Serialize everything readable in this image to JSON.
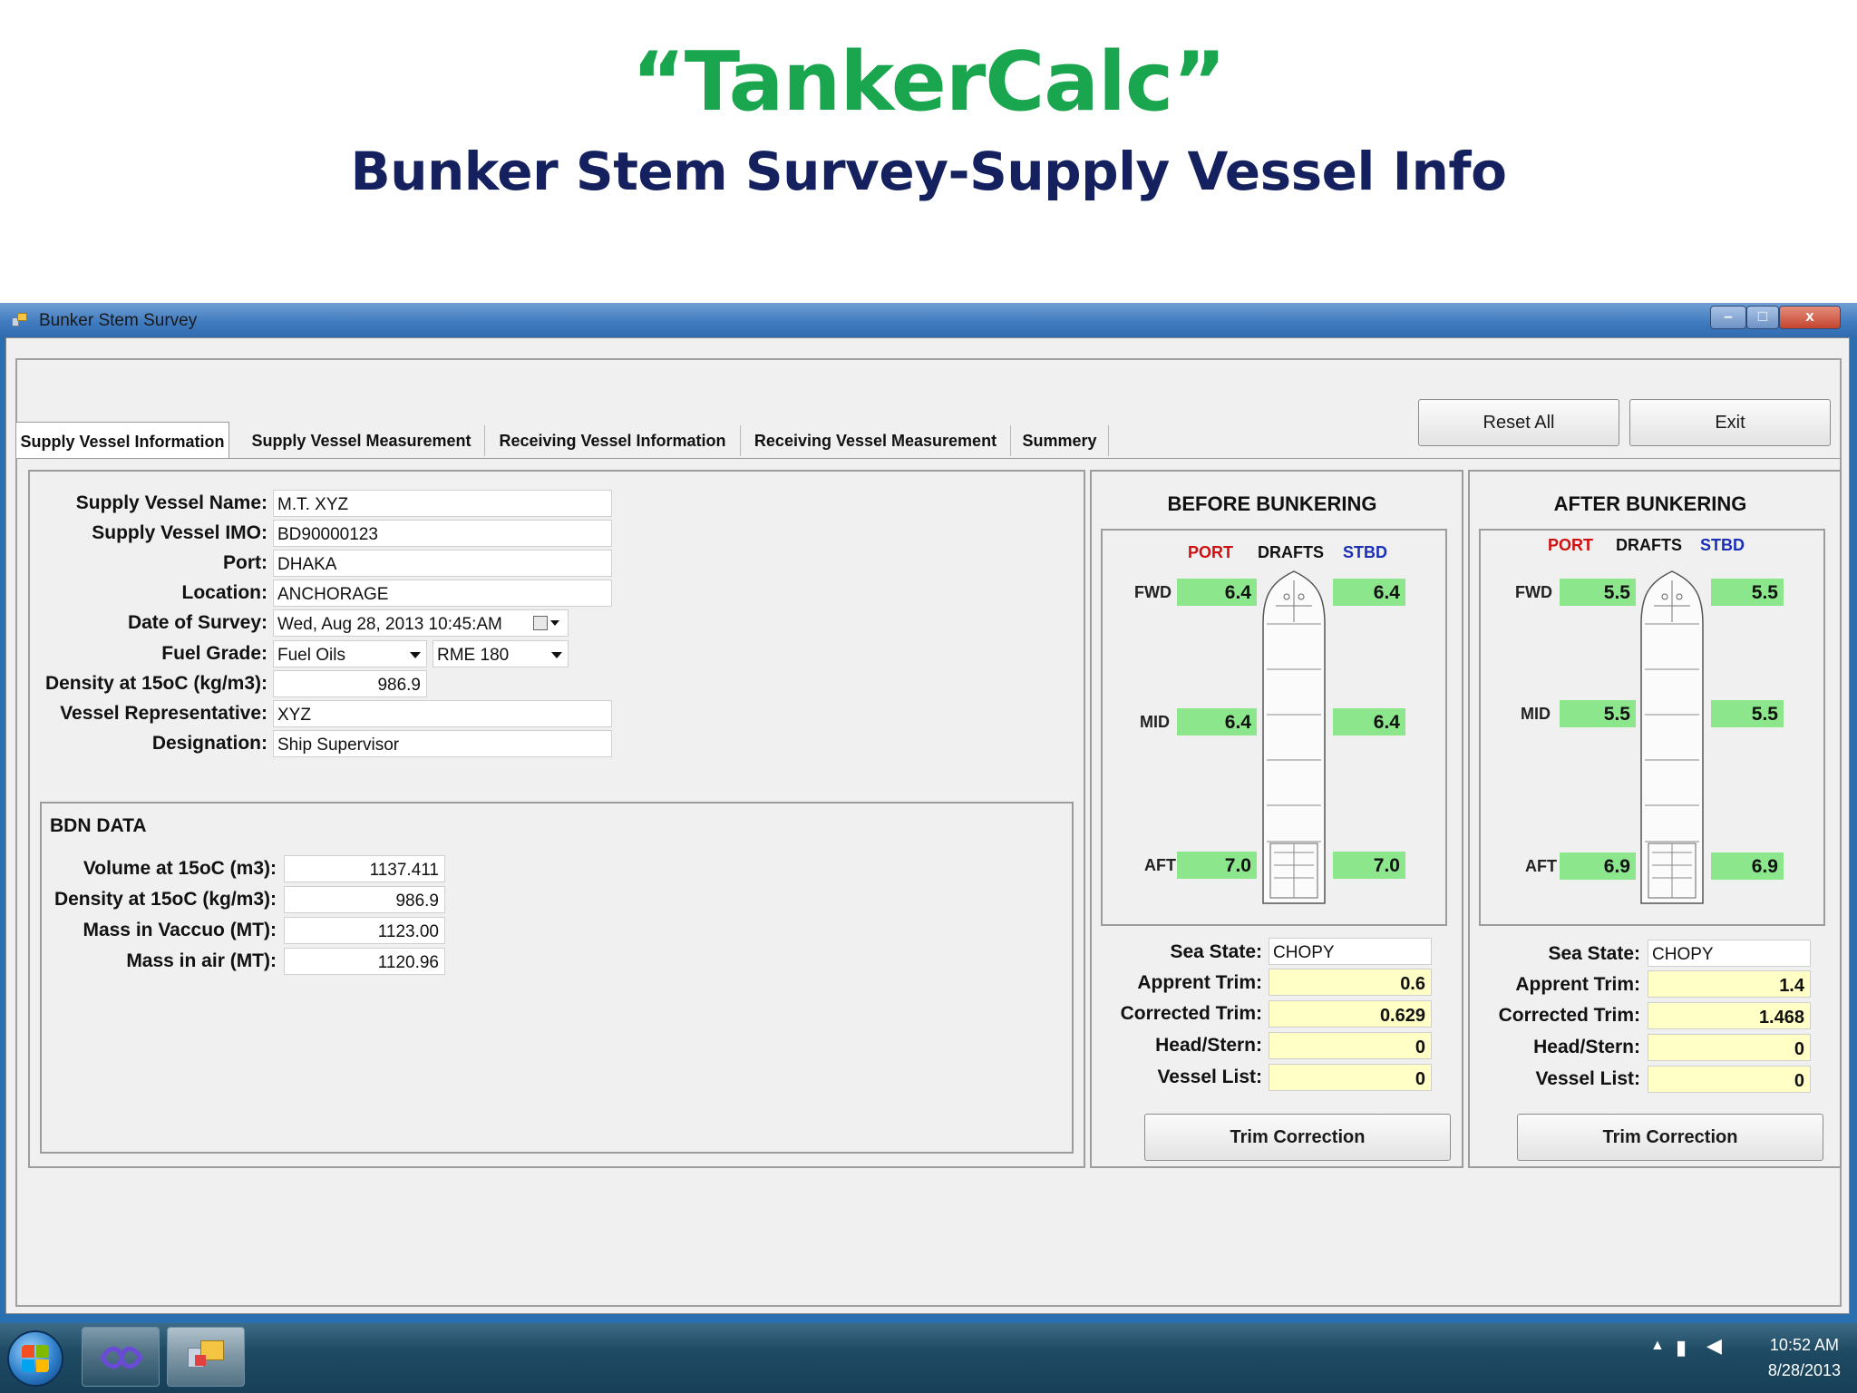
{
  "slide": {
    "title": "“TankerCalc”",
    "subtitle": "Bunker Stem Survey-Supply Vessel Info"
  },
  "window": {
    "title": "Bunker Stem Survey",
    "controls": {
      "minimize": "–",
      "maximize": "□",
      "close": "x"
    }
  },
  "toolbar": {
    "reset_label": "Reset All",
    "exit_label": "Exit"
  },
  "tabs": [
    {
      "label": "Supply Vessel Information",
      "active": true
    },
    {
      "label": "Supply Vessel Measurement",
      "active": false
    },
    {
      "label": "Receiving Vessel Information",
      "active": false
    },
    {
      "label": "Receiving Vessel Measurement",
      "active": false
    },
    {
      "label": "Summery",
      "active": false
    }
  ],
  "vessel_info": {
    "name_label": "Supply Vessel Name:",
    "name_value": "M.T. XYZ",
    "imo_label": "Supply Vessel IMO:",
    "imo_value": "BD90000123",
    "port_label": "Port:",
    "port_value": "DHAKA",
    "location_label": "Location:",
    "location_value": "ANCHORAGE",
    "date_label": "Date of Survey:",
    "date_value": "Wed, Aug 28, 2013 10:45:AM",
    "fuel_label": "Fuel Grade:",
    "fuel_type": "Fuel Oils",
    "fuel_grade": "RME 180",
    "density_label": "Density at 15oC (kg/m3):",
    "density_value": "986.9",
    "rep_label": "Vessel Representative:",
    "rep_value": "XYZ",
    "designation_label": "Designation:",
    "designation_value": "Ship Supervisor"
  },
  "bdn": {
    "title": "BDN DATA",
    "volume_label": "Volume at 15oC (m3):",
    "volume_value": "1137.411",
    "density_label": "Density at 15oC (kg/m3):",
    "density_value": "986.9",
    "mass_vac_label": "Mass in Vaccuo (MT):",
    "mass_vac_value": "1123.00",
    "mass_air_label": "Mass in air (MT):",
    "mass_air_value": "1120.96"
  },
  "drafts_header": {
    "port": "PORT",
    "drafts": "DRAFTS",
    "stbd": "STBD",
    "fwd": "FWD",
    "mid": "MID",
    "aft": "AFT"
  },
  "labels": {
    "sea_state": "Sea State:",
    "apprent_trim": "Apprent Trim:",
    "corrected_trim": "Corrected Trim:",
    "head_stern": "Head/Stern:",
    "vessel_list": "Vessel List:",
    "trim_button": "Trim Correction"
  },
  "before": {
    "title": "BEFORE BUNKERING",
    "fwd_port": "6.4",
    "fwd_stbd": "6.4",
    "mid_port": "6.4",
    "mid_stbd": "6.4",
    "aft_port": "7.0",
    "aft_stbd": "7.0",
    "sea_state": "CHOPY",
    "apprent_trim": "0.6",
    "corrected_trim": "0.629",
    "head_stern": "0",
    "vessel_list": "0"
  },
  "after": {
    "title": "AFTER BUNKERING",
    "fwd_port": "5.5",
    "fwd_stbd": "5.5",
    "mid_port": "5.5",
    "mid_stbd": "5.5",
    "aft_port": "6.9",
    "aft_stbd": "6.9",
    "sea_state": "CHOPY",
    "apprent_trim": "1.4",
    "corrected_trim": "1.468",
    "head_stern": "0",
    "vessel_list": "0"
  },
  "taskbar": {
    "time": "10:52 AM",
    "date": "8/28/2013"
  },
  "colors": {
    "title_green": "#1aa64e",
    "subtitle_navy": "#14215e",
    "draft_green": "#8ce68c",
    "trim_yellow": "#ffffc6",
    "port_red": "#d01010",
    "stbd_blue": "#1a2eb6"
  },
  "icons": [
    "app-icon",
    "minimize-icon",
    "maximize-icon",
    "close-icon",
    "calendar-icon",
    "chevron-down-icon",
    "ship-diagram-icon",
    "windows-start-icon",
    "visual-studio-icon",
    "app-window-icon",
    "tray-arrow-icon",
    "network-icon",
    "speaker-muted-icon"
  ]
}
